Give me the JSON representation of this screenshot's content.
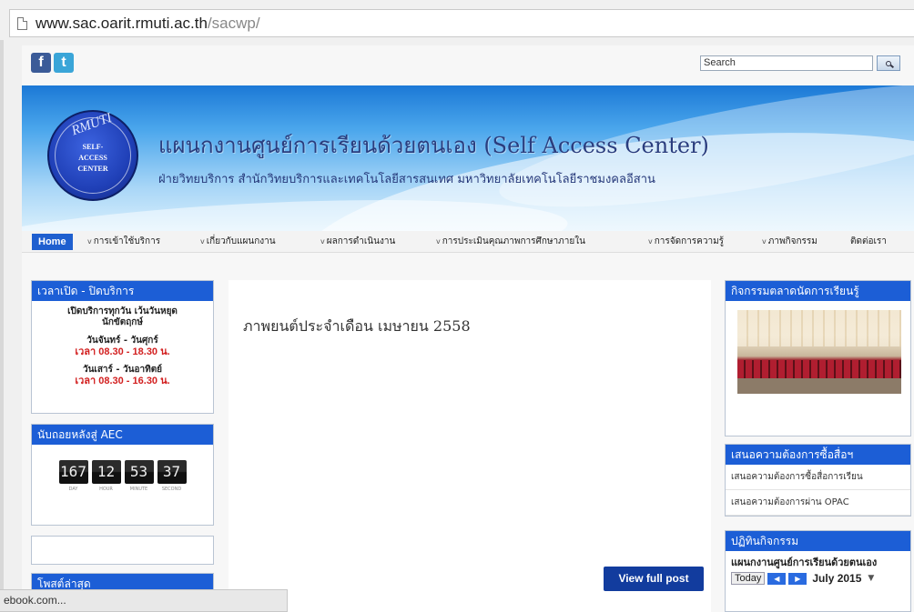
{
  "browser": {
    "url_host": "www.sac.oarit.rmuti.ac.th",
    "url_path": "/sacwp/",
    "status_text": "ebook.com..."
  },
  "social": {
    "facebook": "f",
    "twitter": "t"
  },
  "search": {
    "value": "Search"
  },
  "banner": {
    "logo_arc": "RMUTI",
    "logo_line1": "SELF-",
    "logo_line2": "ACCESS",
    "logo_line3": "CENTER",
    "title": "แผนกงานศูนย์การเรียนด้วยตนเอง (Self Access Center)",
    "subtitle": "ฝ่ายวิทยบริการ สำนักวิทยบริการและเทคโนโลยีสารสนเทศ มหาวิทยาลัยเทคโนโลยีราชมงคลอีสาน"
  },
  "nav": {
    "items": [
      "Home",
      "การเข้าใช้บริการ",
      "เกี่ยวกับแผนกงาน",
      "ผลการดำเนินงาน",
      "การประเมินคุณภาพการศึกษาภายใน",
      "การจัดการความรู้",
      "ภาพกิจกรรม",
      "ติดต่อเรา"
    ]
  },
  "sidebar_left": {
    "hours": {
      "title": "เวลาเปิด - ปิดบริการ",
      "line1": "เปิดบริการทุกวัน เว้นวันหยุด",
      "line2": "นักขัตฤกษ์",
      "weekday_label": "วันจันทร์ - วันศุกร์",
      "weekday_time": "เวลา 08.30 - 18.30 น.",
      "weekend_label": "วันเสาร์ - วันอาทิตย์",
      "weekend_time": "เวลา 08.30 - 16.30 น."
    },
    "aec": {
      "title": "นับถอยหลังสู่ AEC",
      "values": [
        "167",
        "12",
        "53",
        "37"
      ],
      "labels": [
        "DAY",
        "HOUR",
        "MINUTE",
        "SECOND"
      ]
    },
    "recent_title": "โพสต์ล่าสุด"
  },
  "main": {
    "post_title": "ภาพยนต์ประจำเดือน เมษายน 2558",
    "view_full_post": "View full post"
  },
  "sidebar_right": {
    "activities_title": "กิจกรรมตลาดนัดการเรียนรู้",
    "request_title": "เสนอความต้องการซื้อสื่อฯ",
    "request_links": [
      "เสนอความต้องการซื้อสื่อการเรียน",
      "เสนอความต้องการผ่าน OPAC"
    ],
    "calendar": {
      "title": "ปฏิทินกิจกรรม",
      "event_title": "แผนกงานศูนย์การเรียนด้วยตนเอง",
      "today": "Today",
      "month": "July 2015"
    }
  }
}
